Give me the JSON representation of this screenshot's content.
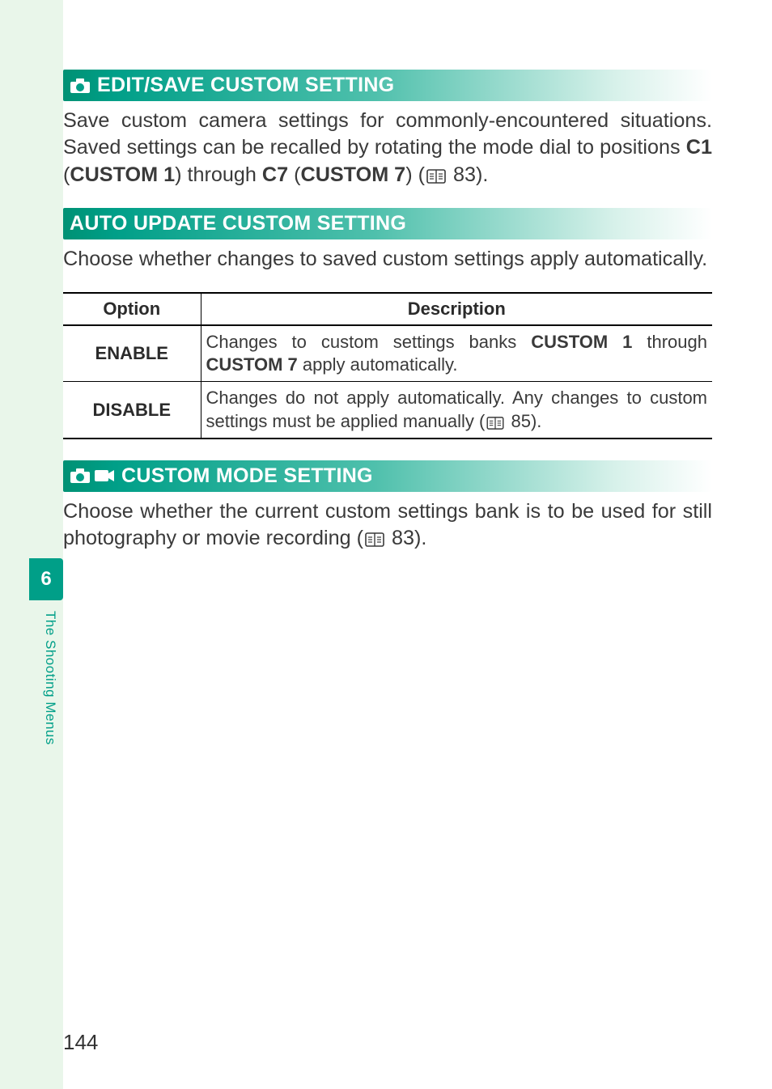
{
  "chapter": {
    "number": "6",
    "side_label": "The Shooting Menus"
  },
  "page_number": "144",
  "sections": {
    "edit_save": {
      "title": "EDIT/SAVE CUSTOM SETTING",
      "body_1": "Save custom camera settings for commonly-encountered situations. Saved settings can be recalled by rotating the mode dial to positions ",
      "c1_label": "C1",
      "c1_paren": "CUSTOM 1",
      "through": ") through ",
      "c7_label": "C7",
      "c7_paren": "CUSTOM 7",
      "tail": ") (",
      "ref": "83",
      "end": ")."
    },
    "auto_update": {
      "title": "AUTO UPDATE CUSTOM SETTING",
      "body": "Choose whether changes to saved custom settings apply automatically.",
      "table": {
        "headers": {
          "option": "Option",
          "description": "Description"
        },
        "rows": [
          {
            "option": "ENABLE",
            "desc_pre": "Changes to custom settings banks ",
            "bank_from": "CUSTOM 1",
            "desc_mid": " through ",
            "bank_to": "CUSTOM 7",
            "desc_post": " apply automatically."
          },
          {
            "option": "DISABLE",
            "desc_pre": "Changes do not apply automatically. Any changes to custom settings must be applied manually (",
            "ref": "85",
            "desc_post": ")."
          }
        ]
      }
    },
    "custom_mode": {
      "title": "CUSTOM MODE SETTING",
      "body_1": "Choose whether the current custom settings bank is to be used for still photography or movie recording (",
      "ref": "83",
      "end": ")."
    }
  }
}
